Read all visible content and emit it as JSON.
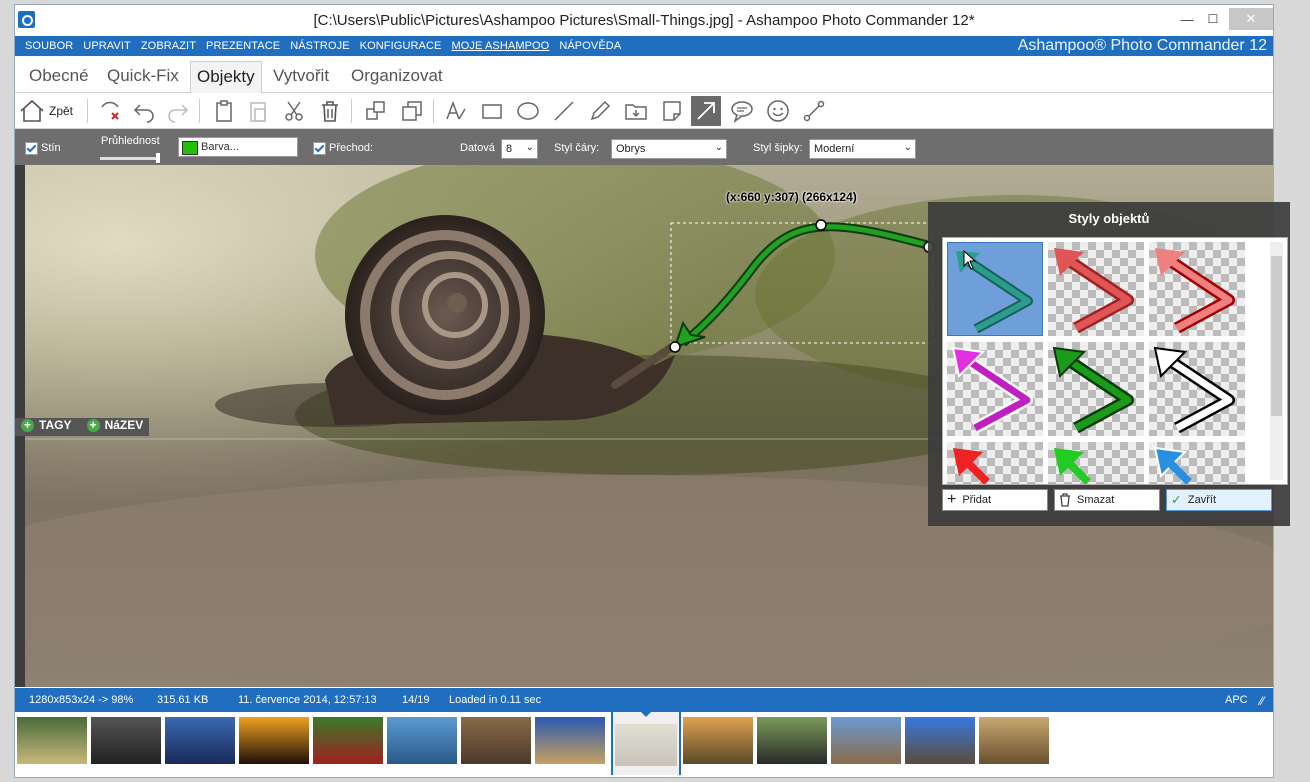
{
  "window": {
    "title": "[C:\\Users\\Public\\Pictures\\Ashampoo Pictures\\Small-Things.jpg] - Ashampoo Photo Commander 12*",
    "minimize": "—",
    "maximize": "☐",
    "close": "✕"
  },
  "menu": {
    "items": [
      "SOUBOR",
      "UPRAVIT",
      "ZOBRAZIT",
      "PREZENTACE",
      "NÁSTROJE",
      "KONFIGURACE",
      "MOJE ASHAMPOO",
      "NÁPOVĚDA"
    ],
    "brand": "Ashampoo® Photo Commander 12"
  },
  "tabs": [
    "Obecné",
    "Quick-Fix",
    "Objekty",
    "Vytvořit",
    "Organizovat"
  ],
  "active_tab": "Objekty",
  "toolbar": {
    "back_label": "Zpět",
    "icons": [
      "delete-selection-icon",
      "undo-icon",
      "redo-icon",
      "copy-icon",
      "paste-icon",
      "cut-icon",
      "trash-icon",
      "bring-front-icon",
      "send-back-icon",
      "text-tool-icon",
      "rectangle-tool-icon",
      "ellipse-tool-icon",
      "line-tool-icon",
      "pen-tool-icon",
      "image-insert-icon",
      "sticker-icon",
      "arrow-tool-icon",
      "speech-bubble-icon",
      "smiley-icon",
      "connector-icon"
    ],
    "active_tool": "arrow-tool-icon"
  },
  "options": {
    "shadow_label": "Stín",
    "opacity_label": "Průhlednost",
    "color_label": "Barva...",
    "color": "#22c000",
    "gradient_label": "Přechod:",
    "data_label": "Datová",
    "data_value": "8",
    "line_style_label": "Styl čáry:",
    "line_style_value": "Obrys",
    "arrow_style_label": "Styl šipky:",
    "arrow_style_value": "Moderní"
  },
  "canvas": {
    "coord_readout": "(x:660 y:307) (266x124)",
    "tags_label": "TAGY",
    "name_label": "NáZEV"
  },
  "styles_panel": {
    "title": "Styly objektů",
    "arrow_colors": [
      "#2a9d8f",
      "#e05555",
      "#e05555",
      "#d63bd6",
      "#1a9c1a",
      "#ffffff",
      "#ee2222",
      "#22cc22",
      "#2a8fe0"
    ],
    "add_label": "Přidat",
    "delete_label": "Smazat",
    "close_label": "Zavřít"
  },
  "status": {
    "dimensions": "1280x853x24 -> 98%",
    "size": "315.61 KB",
    "date": "11. července 2014, 12:57:13",
    "index": "14/19",
    "loaded": "Loaded in 0.11 sec",
    "right": "APC"
  },
  "filmstrip": {
    "count": 14,
    "selected_index": 8
  }
}
